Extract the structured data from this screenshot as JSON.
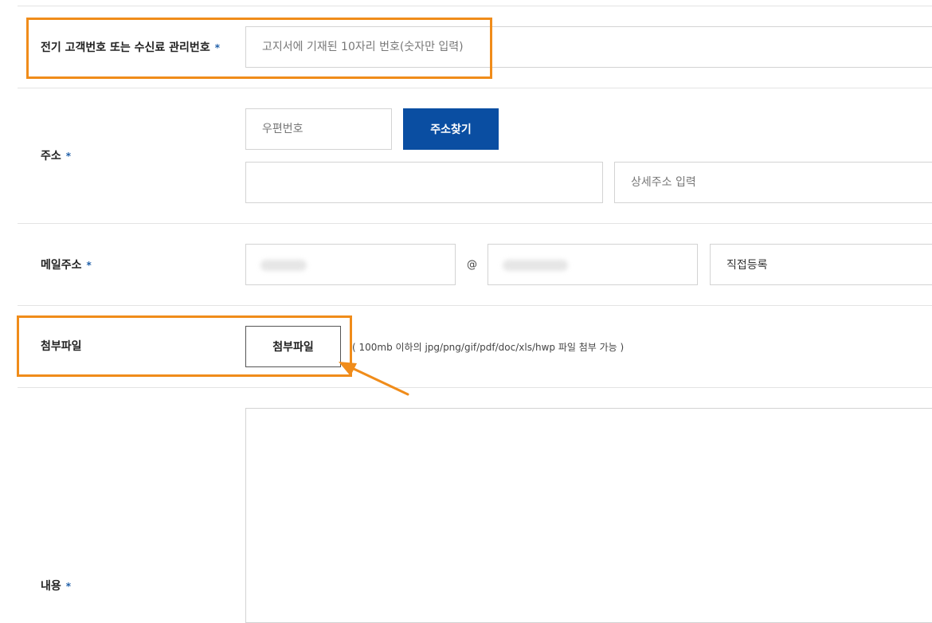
{
  "form": {
    "customer_number": {
      "label": "전기 고객번호 또는 수신료 관리번호",
      "required_mark": "*",
      "placeholder": "고지서에 기재된 10자리 번호(숫자만 입력)"
    },
    "address": {
      "label": "주소",
      "required_mark": "*",
      "zip_placeholder": "우편번호",
      "search_button": "주소찾기",
      "detail_placeholder": "상세주소 입력"
    },
    "email": {
      "label": "메일주소",
      "required_mark": "*",
      "at_symbol": "@",
      "domain_select": "직접등록"
    },
    "attachment": {
      "label": "첨부파일",
      "button": "첨부파일",
      "hint": "( 100mb 이하의 jpg/png/gif/pdf/doc/xls/hwp 파일 첨부 가능 )"
    },
    "content": {
      "label": "내용",
      "required_mark": "*"
    }
  },
  "colors": {
    "primary_button": "#0a4ea2",
    "highlight": "#f08c1a",
    "required_star": "#1f5fa8"
  }
}
